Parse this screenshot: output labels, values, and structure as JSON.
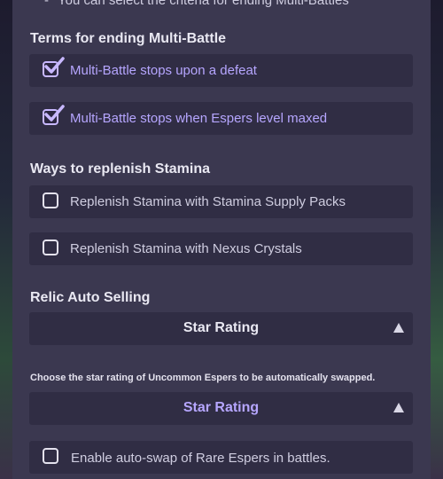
{
  "top_note": "You can select the criteria for ending Multi-Battles",
  "terms_section": {
    "title": "Terms for ending Multi-Battle",
    "options": [
      {
        "label": "Multi-Battle stops upon a defeat",
        "checked": true
      },
      {
        "label": "Multi-Battle stops when Espers level maxed",
        "checked": true
      }
    ]
  },
  "stamina_section": {
    "title": "Ways to replenish Stamina",
    "options": [
      {
        "label": "Replenish Stamina with Stamina Supply Packs",
        "checked": false
      },
      {
        "label": "Replenish Stamina with Nexus Crystals",
        "checked": false
      }
    ]
  },
  "relic_section": {
    "title": "Relic Auto Selling",
    "dropdown_value": "Star Rating"
  },
  "uncommon_swap": {
    "hint": "Choose the star rating of Uncommon Espers to be automatically swapped.",
    "dropdown_value": "Star Rating"
  },
  "rare_swap": {
    "label": "Enable auto-swap of Rare Espers in battles.",
    "checked": false
  },
  "colors": {
    "accent": "#b6a6ff",
    "panel": "#3b3850",
    "row_bg": "#302d44"
  }
}
